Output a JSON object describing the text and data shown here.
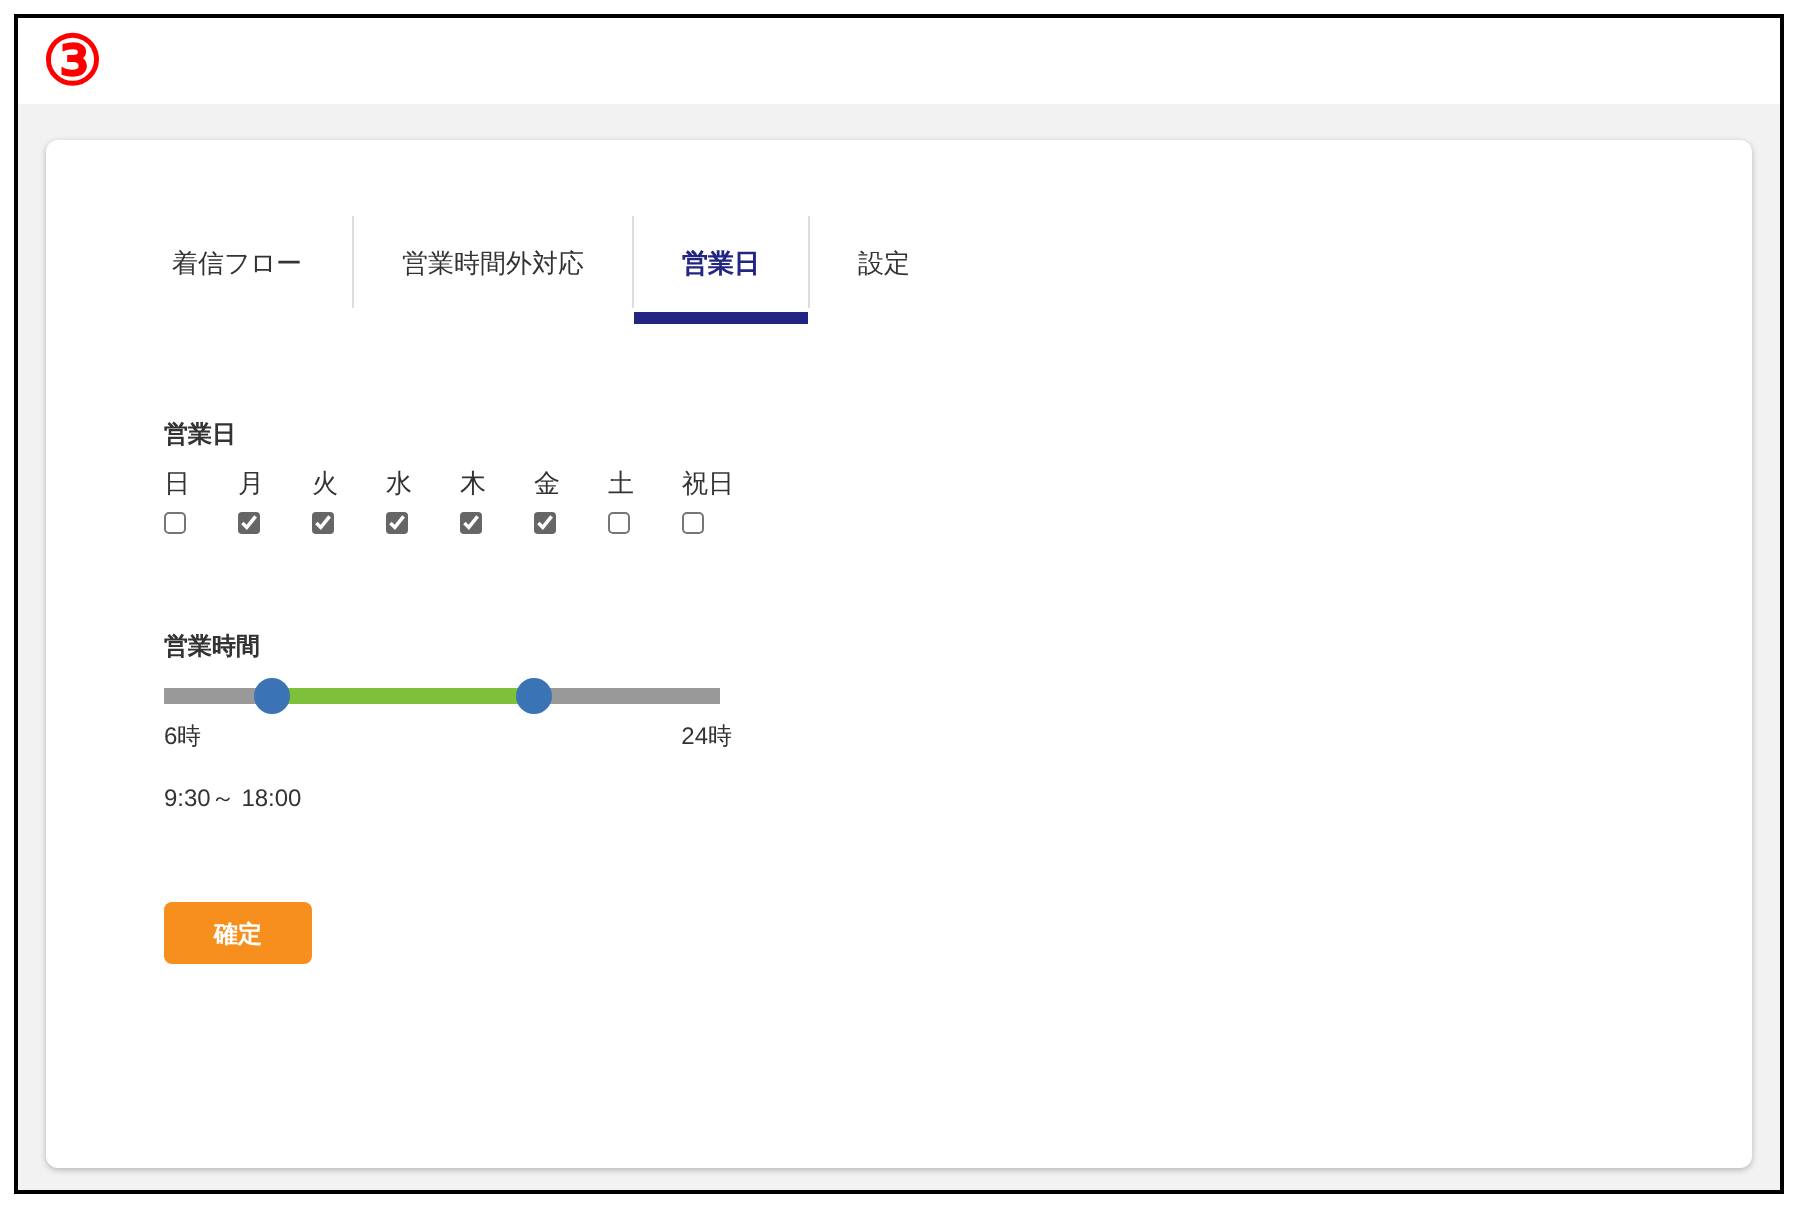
{
  "step_marker": "③",
  "tabs": [
    {
      "label": "着信フロー",
      "selected": false
    },
    {
      "label": "営業時間外対応",
      "selected": false
    },
    {
      "label": "営業日",
      "selected": true
    },
    {
      "label": "設定",
      "selected": false
    }
  ],
  "business_days": {
    "title": "営業日",
    "days": [
      {
        "label": "日",
        "checked": false
      },
      {
        "label": "月",
        "checked": true
      },
      {
        "label": "火",
        "checked": true
      },
      {
        "label": "水",
        "checked": true
      },
      {
        "label": "木",
        "checked": true
      },
      {
        "label": "金",
        "checked": true
      },
      {
        "label": "土",
        "checked": false
      },
      {
        "label": "祝日",
        "checked": false
      }
    ]
  },
  "business_hours": {
    "title": "営業時間",
    "start": {
      "level": 0.194
    },
    "end": {
      "level": 0.667
    },
    "min_label": "6時",
    "max_label": "24時",
    "reading": "9:30～ 18:00"
  },
  "confirm_button": "確定"
}
